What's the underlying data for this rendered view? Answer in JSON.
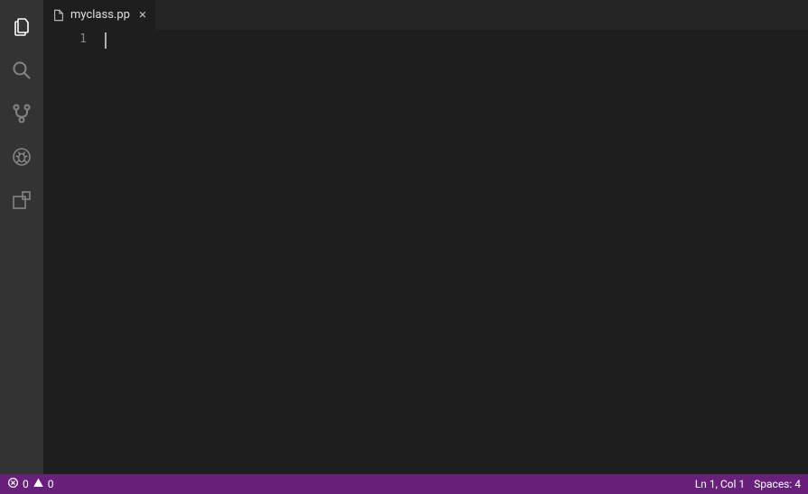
{
  "tab": {
    "filename": "myclass.pp"
  },
  "gutter": {
    "line1": "1"
  },
  "status": {
    "errors": "0",
    "warnings": "0",
    "cursor": "Ln 1, Col 1",
    "indent": "Spaces: 4"
  }
}
